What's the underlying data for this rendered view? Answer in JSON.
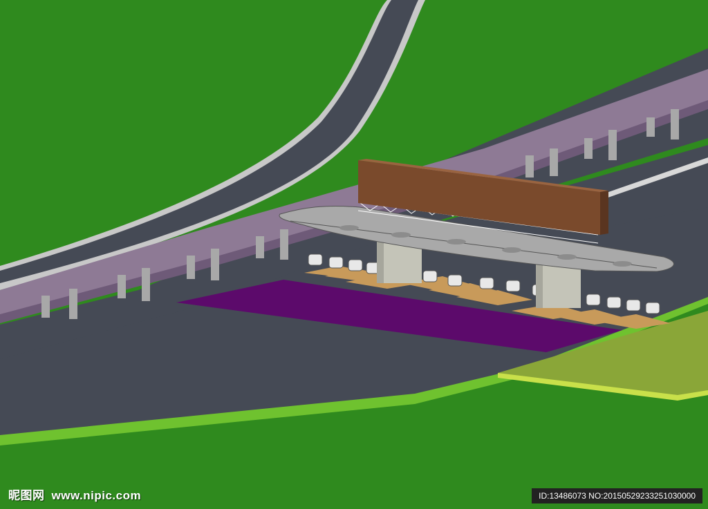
{
  "watermark": {
    "brand": "昵图网",
    "site": "www.nipic.com",
    "image_id": "ID:13486073 NO:20150529233251030000"
  },
  "colors": {
    "grass": "#2f8a1e",
    "grass_light": "#6fc22f",
    "grass_yellow": "#8aa638",
    "road": "#454a55",
    "viaduct_deck": "#8e7a95",
    "canopy": "#a9a9a9",
    "billboard": "#7a4a2c",
    "lane_marking": "#5c0a6b",
    "pier": "#c4c4b8",
    "island": "#c89a5a"
  },
  "scene": {
    "description_icons": [
      "toll-plaza",
      "elevated-viaduct",
      "curved-ramp",
      "billboard",
      "toll-booth"
    ],
    "booth_count": 16
  }
}
